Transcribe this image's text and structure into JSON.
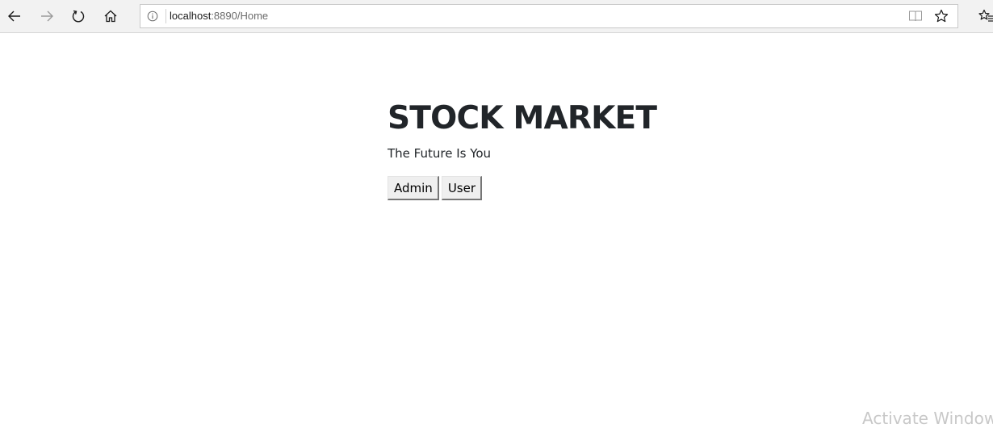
{
  "browser": {
    "url_host": "localhost",
    "url_rest": ":8890/Home",
    "icons": {
      "back": "back-arrow-icon",
      "forward": "forward-arrow-icon",
      "refresh": "refresh-icon",
      "home": "home-icon",
      "site_info": "info-icon",
      "reading_view": "reading-view-icon",
      "favorite": "star-icon",
      "favorites_hub": "favorites-hub-icon"
    }
  },
  "page": {
    "title": "STOCK MARKET",
    "subtitle": "The Future Is You",
    "buttons": {
      "admin": "Admin",
      "user": "User"
    }
  },
  "watermark": "Activate Windows"
}
